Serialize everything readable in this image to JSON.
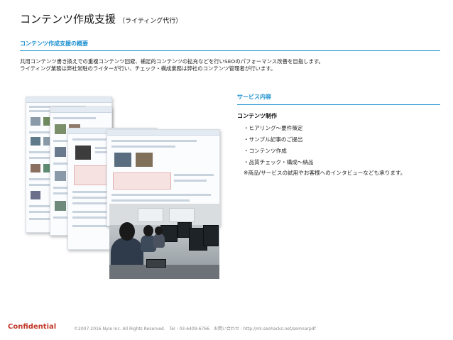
{
  "header": {
    "title": "コンテンツ作成支援",
    "subtitle": "（ライティング代行）"
  },
  "overview": {
    "heading": "コンテンツ作成支援の概要",
    "lines": [
      "共用コンテンツ書き換えでの重複コンテンツ回避、補足的コンテンツの拡充などを行いSEOのパフォーマンス改善を目指します。",
      "ライティング業務は弊社常駐のライターが行い、チェック・構成業務は弊社のコンテンツ管理者が行います。"
    ]
  },
  "services": {
    "heading": "サービス内容",
    "subtitle": "コンテンツ制作",
    "items": [
      "・ヒアリング～要件策定",
      "・サンプル記事のご提出",
      "・コンテンツ作成",
      "・品質チェック・構成～納品"
    ],
    "note": "※商品/サービスの試用やお客様へのインタビューなども承ります。"
  },
  "footer": {
    "confidential": "Confidential",
    "copyright": "©2007-2016 Nyle Inc. All Rights Reserved.　Tel : 03-6409-6766　お問い合わせ : http://ml.seohacks.net/semnarpdf"
  },
  "colors": {
    "accent": "#1a8fcf",
    "confidential": "#c0392b"
  }
}
